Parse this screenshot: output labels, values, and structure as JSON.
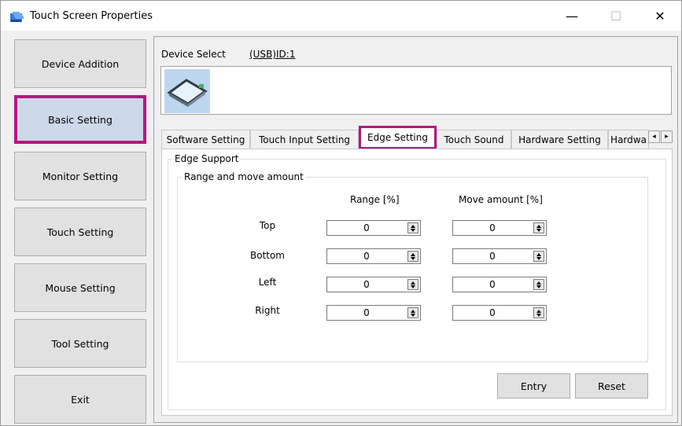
{
  "window": {
    "title": "Touch Screen Properties",
    "min_glyph": "—",
    "max_glyph": "☐",
    "close_glyph": "✕"
  },
  "sidebar": {
    "items": [
      {
        "label": "Device Addition"
      },
      {
        "label": "Basic Setting",
        "active": true
      },
      {
        "label": "Monitor Setting"
      },
      {
        "label": "Touch Setting"
      },
      {
        "label": "Mouse Setting"
      },
      {
        "label": "Tool Setting"
      },
      {
        "label": "Exit"
      }
    ]
  },
  "device": {
    "label": "Device Select",
    "value": "(USB)ID:1",
    "icon": "touch-panel-icon"
  },
  "tabs": [
    {
      "label": "Software Setting"
    },
    {
      "label": "Touch Input Setting"
    },
    {
      "label": "Edge Setting",
      "active": true
    },
    {
      "label": "Touch Sound"
    },
    {
      "label": "Hardware Setting"
    },
    {
      "label": "Hardwa"
    }
  ],
  "tab_scroll": {
    "left": "◂",
    "right": "▸"
  },
  "edge": {
    "group_title": "Edge Support",
    "range_group_title": "Range and move amount",
    "col_range": "Range [%]",
    "col_move": "Move amount [%]",
    "rows": [
      {
        "label": "Top",
        "range": "0",
        "move": "0"
      },
      {
        "label": "Bottom",
        "range": "0",
        "move": "0"
      },
      {
        "label": "Left",
        "range": "0",
        "move": "0"
      },
      {
        "label": "Right",
        "range": "0",
        "move": "0"
      }
    ]
  },
  "buttons": {
    "entry": "Entry",
    "reset": "Reset"
  },
  "colors": {
    "highlight": "#b3187f",
    "active_button_bg": "#ccd9e8",
    "window_bg": "#f0f0f0"
  }
}
